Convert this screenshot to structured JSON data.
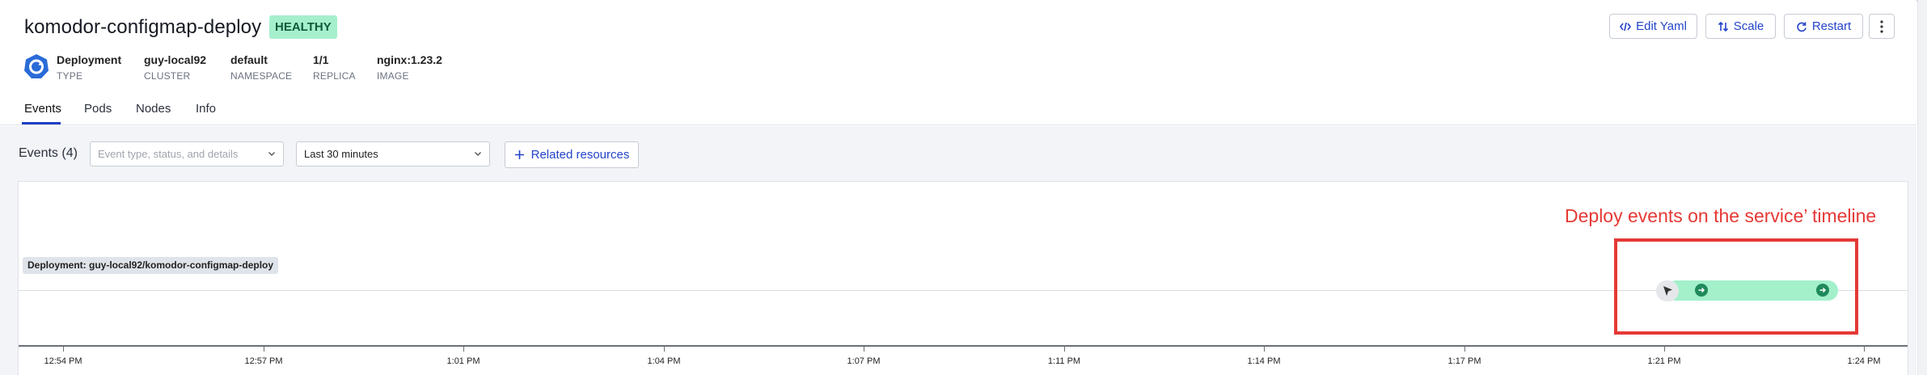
{
  "header": {
    "title": "komodor-configmap-deploy",
    "status": "HEALTHY",
    "meta": [
      {
        "value": "Deployment",
        "label": "TYPE"
      },
      {
        "value": "guy-local92",
        "label": "CLUSTER"
      },
      {
        "value": "default",
        "label": "NAMESPACE"
      },
      {
        "value": "1/1",
        "label": "REPLICA"
      },
      {
        "value": "nginx:1.23.2",
        "label": "IMAGE"
      }
    ],
    "actions": {
      "edit_yaml": "Edit Yaml",
      "scale": "Scale",
      "restart": "Restart"
    },
    "icons": {
      "type": "deployment-icon",
      "more": "kebab-menu-icon"
    }
  },
  "tabs": [
    "Events",
    "Pods",
    "Nodes",
    "Info"
  ],
  "active_tab": "Events",
  "events": {
    "title": "Events (4)",
    "filter_placeholder": "Event type, status, and details",
    "time_range": "Last 30 minutes",
    "related_resources": "Related resources"
  },
  "timeline": {
    "annotation": "Deploy events on the service’ timeline",
    "row_label": "Deployment: guy-local92/komodor-configmap-deploy",
    "ticks": [
      "12:54 PM",
      "12:57 PM",
      "1:01 PM",
      "1:04 PM",
      "1:07 PM",
      "1:11 PM",
      "1:14 PM",
      "1:17 PM",
      "1:21 PM",
      "1:24 PM"
    ]
  },
  "colors": {
    "accent": "#1d3fc4",
    "healthy_bg": "#a6efcd",
    "deploy_bar": "#a3f0cb",
    "deploy_dot": "#1f8a5b",
    "annotation_red": "#e53935"
  }
}
